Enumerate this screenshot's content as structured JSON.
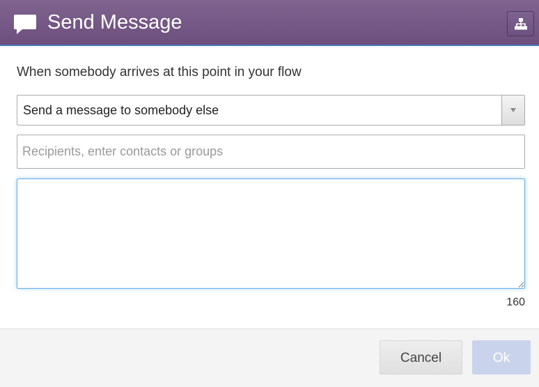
{
  "dialog": {
    "title": "Send Message",
    "title_icon": "message-bubble-icon",
    "flow_icon": "sitemap-icon"
  },
  "body": {
    "intro": "When somebody arrives at this point in your flow",
    "action_select": {
      "selected": "Send a message to somebody else"
    },
    "recipients": {
      "value": "",
      "placeholder": "Recipients, enter contacts or groups"
    },
    "message": {
      "value": "",
      "char_count": "160"
    }
  },
  "footer": {
    "cancel_label": "Cancel",
    "ok_label": "Ok"
  },
  "colors": {
    "header": "#6c4f7d",
    "ok_disabled": "#c9d4ec",
    "focus": "#66afe9"
  }
}
